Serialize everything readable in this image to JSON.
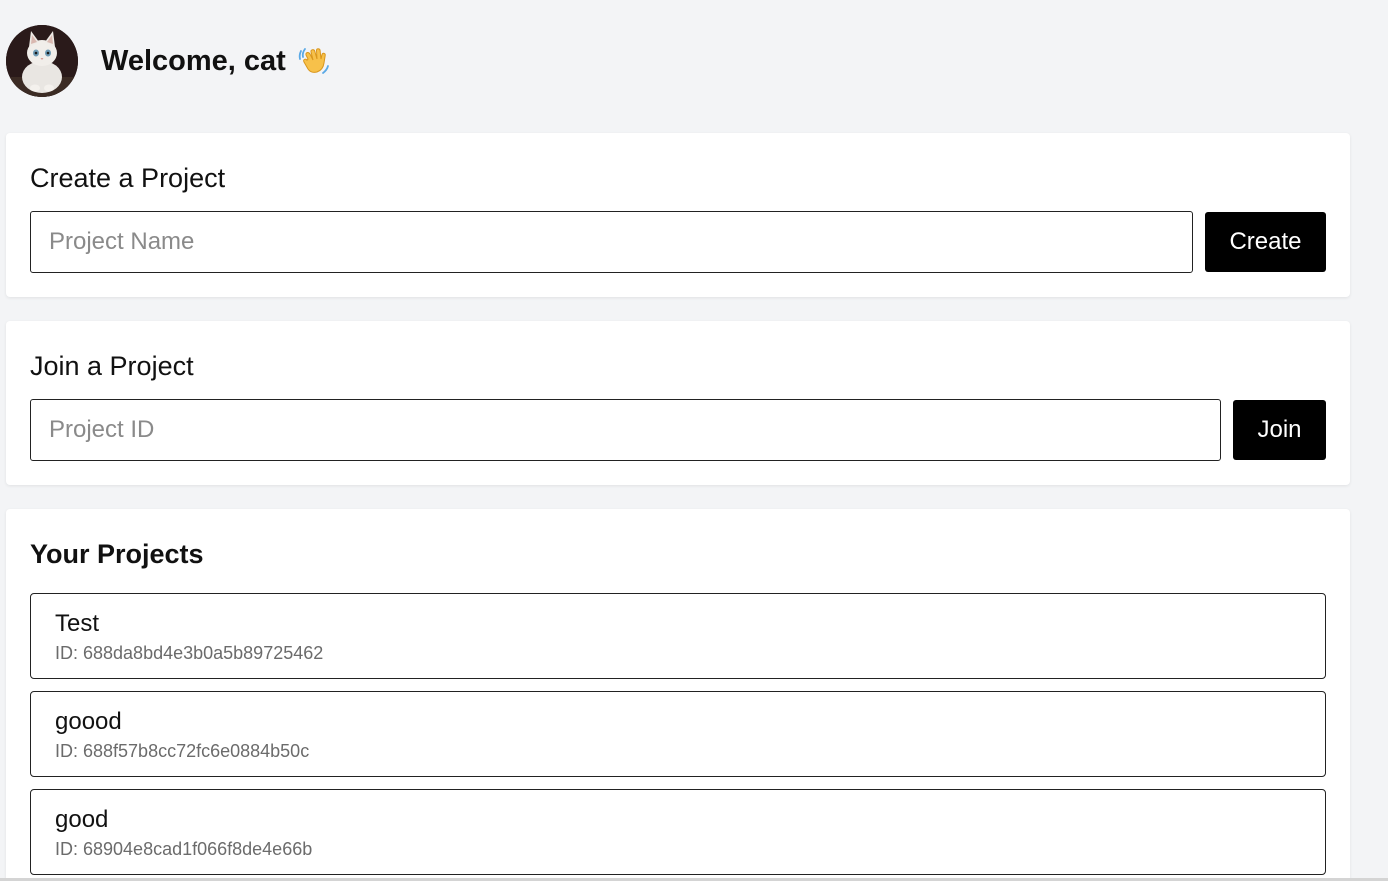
{
  "header": {
    "welcome_text": "Welcome, cat",
    "wave_icon": "waving-hand-icon",
    "avatar_icon": "cat-avatar"
  },
  "create": {
    "title": "Create a Project",
    "placeholder": "Project Name",
    "value": "",
    "button_label": "Create"
  },
  "join": {
    "title": "Join a Project",
    "placeholder": "Project ID",
    "value": "",
    "button_label": "Join"
  },
  "projects": {
    "title": "Your Projects",
    "items": [
      {
        "name": "Test",
        "id_text": "ID: 688da8bd4e3b0a5b89725462"
      },
      {
        "name": "goood",
        "id_text": "ID: 688f57b8cc72fc6e0884b50c"
      },
      {
        "name": "good",
        "id_text": "ID: 68904e8cad1f066f8de4e66b"
      }
    ]
  },
  "colors": {
    "background": "#f3f4f6",
    "card": "#ffffff",
    "button": "#000000",
    "button_text": "#ffffff",
    "muted_text": "#6b6b6b"
  }
}
